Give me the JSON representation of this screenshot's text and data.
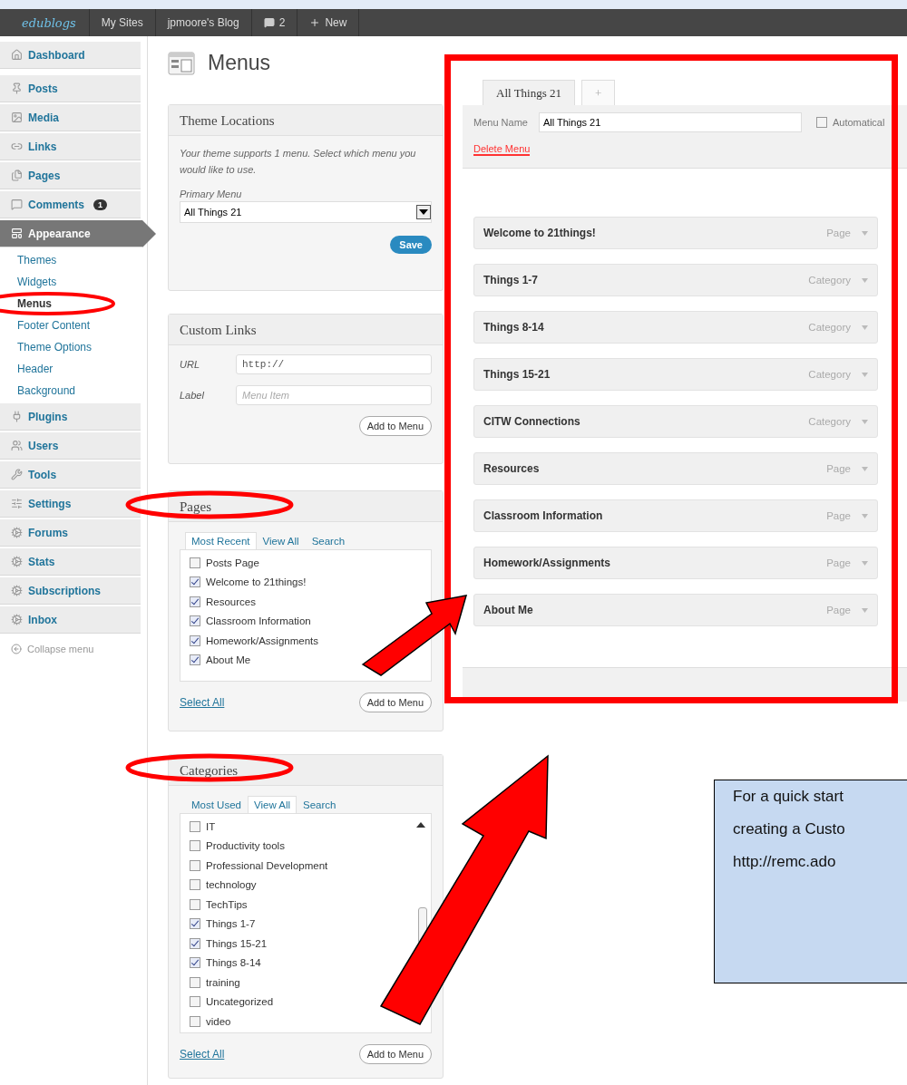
{
  "admin_bar": {
    "logo": "edublogs",
    "items": [
      {
        "label": "My Sites",
        "kind": "text"
      },
      {
        "label": "jpmoore's Blog",
        "kind": "text"
      },
      {
        "label": "2",
        "kind": "comments"
      },
      {
        "label": "New",
        "kind": "new"
      }
    ]
  },
  "sidebar": {
    "items": [
      {
        "label": "Dashboard",
        "kind": "menu",
        "selected": false
      },
      {
        "label": "Posts",
        "kind": "menu",
        "selected": false
      },
      {
        "label": "Media",
        "kind": "menu",
        "selected": false
      },
      {
        "label": "Links",
        "kind": "menu",
        "selected": false
      },
      {
        "label": "Pages",
        "kind": "menu",
        "selected": false
      },
      {
        "label": "Comments",
        "kind": "menu",
        "selected": false,
        "badge": "1"
      },
      {
        "label": "Appearance",
        "kind": "menu",
        "selected": true
      },
      {
        "label": "Themes",
        "kind": "submenu",
        "selected": false
      },
      {
        "label": "Widgets",
        "kind": "submenu",
        "selected": false
      },
      {
        "label": "Menus",
        "kind": "submenu",
        "selected": true
      },
      {
        "label": "Footer Content",
        "kind": "submenu",
        "selected": false
      },
      {
        "label": "Theme Options",
        "kind": "submenu",
        "selected": false
      },
      {
        "label": "Header",
        "kind": "submenu",
        "selected": false
      },
      {
        "label": "Background",
        "kind": "submenu",
        "selected": false
      },
      {
        "label": "Plugins",
        "kind": "menu",
        "selected": false
      },
      {
        "label": "Users",
        "kind": "menu",
        "selected": false
      },
      {
        "label": "Tools",
        "kind": "menu",
        "selected": false
      },
      {
        "label": "Settings",
        "kind": "menu",
        "selected": false
      },
      {
        "label": "Forums",
        "kind": "menu",
        "selected": false
      },
      {
        "label": "Stats",
        "kind": "menu",
        "selected": false
      },
      {
        "label": "Subscriptions",
        "kind": "menu",
        "selected": false
      },
      {
        "label": "Inbox",
        "kind": "menu",
        "selected": false
      },
      {
        "label": "Collapse menu",
        "kind": "collapse"
      }
    ]
  },
  "page_title": "Menus",
  "theme_locations": {
    "title": "Theme Locations",
    "description": "Your theme supports 1 menu. Select which menu you would like to use.",
    "select_label": "Primary Menu",
    "select_value": "All Things 21",
    "button": "Save"
  },
  "custom_links": {
    "title": "Custom Links",
    "url_label": "URL",
    "url_value": "http://",
    "label_label": "Label",
    "label_placeholder": "Menu Item",
    "button": "Add to Menu"
  },
  "pages": {
    "title": "Pages",
    "tabs": [
      {
        "label": "Most Recent",
        "selected": true
      },
      {
        "label": "View All",
        "selected": false
      },
      {
        "label": "Search",
        "selected": false
      }
    ],
    "items": [
      {
        "label": "Posts Page",
        "checked": false
      },
      {
        "label": "Welcome to 21things!",
        "checked": true
      },
      {
        "label": "Resources",
        "checked": true
      },
      {
        "label": "Classroom Information",
        "checked": true
      },
      {
        "label": "Homework/Assignments",
        "checked": true
      },
      {
        "label": "About Me",
        "checked": true
      }
    ],
    "select_all": "Select All",
    "button": "Add to Menu"
  },
  "categories": {
    "title": "Categories",
    "tabs": [
      {
        "label": "Most Used",
        "selected": false
      },
      {
        "label": "View All",
        "selected": true
      },
      {
        "label": "Search",
        "selected": false
      }
    ],
    "items": [
      {
        "label": "IT",
        "checked": false
      },
      {
        "label": "Productivity tools",
        "checked": false
      },
      {
        "label": "Professional Development",
        "checked": false
      },
      {
        "label": "technology",
        "checked": false
      },
      {
        "label": "TechTips",
        "checked": false
      },
      {
        "label": "Things 1-7",
        "checked": true
      },
      {
        "label": "Things 15-21",
        "checked": true
      },
      {
        "label": "Things 8-14",
        "checked": true
      },
      {
        "label": "training",
        "checked": false
      },
      {
        "label": "Uncategorized",
        "checked": false
      },
      {
        "label": "video",
        "checked": false
      }
    ],
    "select_all": "Select All",
    "button": "Add to Menu"
  },
  "menu_editor": {
    "tabs": [
      {
        "label": "All Things 21",
        "selected": true
      },
      {
        "label": "+",
        "selected": false
      }
    ],
    "name_label": "Menu Name",
    "name_value": "All Things 21",
    "auto_add": {
      "label": "Automatical",
      "checked": false
    },
    "delete": "Delete Menu",
    "items": [
      {
        "title": "Welcome to 21things!",
        "type": "Page"
      },
      {
        "title": "Things 1-7",
        "type": "Category"
      },
      {
        "title": "Things 8-14",
        "type": "Category"
      },
      {
        "title": "Things 15-21",
        "type": "Category"
      },
      {
        "title": "CITW Connections",
        "type": "Category"
      },
      {
        "title": "Resources",
        "type": "Page"
      },
      {
        "title": "Classroom Information",
        "type": "Page"
      },
      {
        "title": "Homework/Assignments",
        "type": "Page"
      },
      {
        "title": "About Me",
        "type": "Page"
      }
    ]
  },
  "note": {
    "lines": [
      "For a quick start",
      "creating a Custo",
      "http://remc.ado"
    ]
  }
}
